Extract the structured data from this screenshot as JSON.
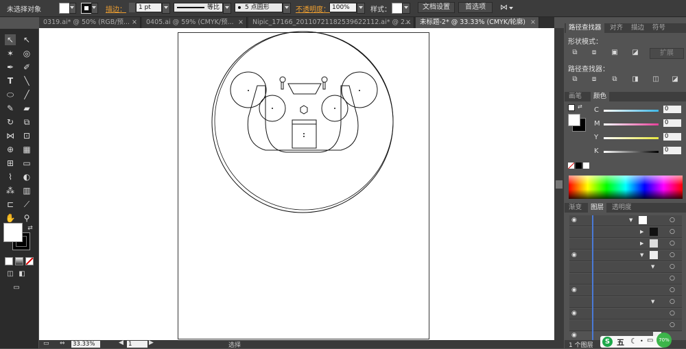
{
  "control_bar": {
    "selection_label": "未选择对象",
    "stroke_label": "描边：",
    "stroke_weight": "1 pt",
    "stroke_profile": "等比",
    "brush": "5 点圆形",
    "opacity_label": "不透明度：",
    "opacity_value": "100%",
    "style_label": "样式：",
    "doc_setup_button": "文档设置",
    "preferences_button": "首选项"
  },
  "tabs": [
    {
      "label": "0319.ai* @ 50% (RGB/预..."
    },
    {
      "label": "0405.ai @ 59% (CMYK/预..."
    },
    {
      "label": "Nipic_17166_20110721182539622112.ai* @ 2..."
    },
    {
      "label": "未标题-2* @ 33.33% (CMYK/轮廓)"
    }
  ],
  "status_bar": {
    "zoom": "33.33%",
    "page": "1",
    "tool_status": "选择"
  },
  "pathfinder_panel": {
    "tabs": [
      "路径查找器",
      "对齐",
      "描边",
      "符号"
    ],
    "shape_modes_label": "形状模式：",
    "expand_button": "扩展",
    "pathfinders_label": "路径查找器："
  },
  "color_panel": {
    "tabs": [
      "画笔",
      "颜色"
    ],
    "channels": [
      {
        "name": "C",
        "value": "0",
        "color": "#3fb8e6"
      },
      {
        "name": "M",
        "value": "0",
        "color": "#e63f9a"
      },
      {
        "name": "Y",
        "value": "0",
        "color": "#e6e63f"
      },
      {
        "name": "K",
        "value": "0",
        "color": "#888888"
      }
    ]
  },
  "layers_panel": {
    "tabs": [
      "渐变",
      "图层",
      "透明度"
    ],
    "footer": "1 个图层"
  },
  "overlay": {
    "ime_brand": "五",
    "badge": "70%"
  }
}
